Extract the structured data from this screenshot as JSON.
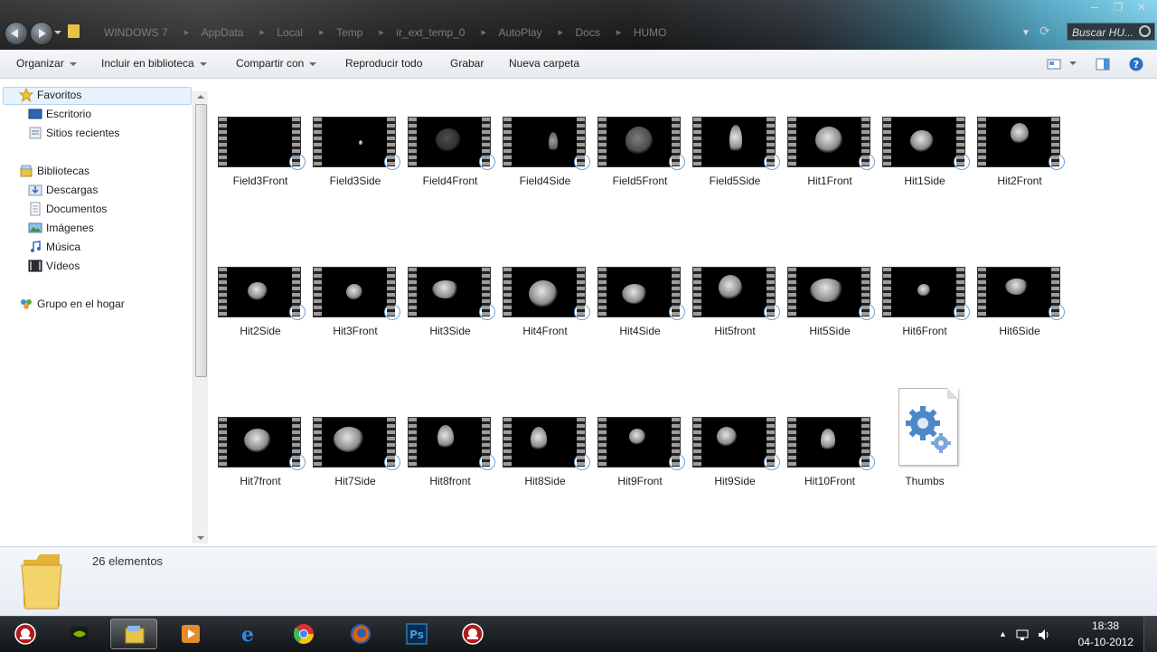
{
  "address": {
    "crumbs": [
      "WINDOWS 7",
      "AppData",
      "Local",
      "Temp",
      "ir_ext_temp_0",
      "AutoPlay",
      "Docs",
      "HUMO"
    ],
    "search_placeholder": "Buscar HU..."
  },
  "toolbar": {
    "organize": "Organizar",
    "include": "Incluir en biblioteca",
    "share": "Compartir con",
    "play_all": "Reproducir todo",
    "burn": "Grabar",
    "new_folder": "Nueva carpeta"
  },
  "sidebar": {
    "favorites": "Favoritos",
    "favorites_items": [
      "Escritorio",
      "Sitios recientes"
    ],
    "libraries": "Bibliotecas",
    "libraries_items": [
      "Descargas",
      "Documentos",
      "Imágenes",
      "Música",
      "Vídeos"
    ],
    "homegroup": "Grupo en el hogar"
  },
  "files": [
    {
      "name": "Field3Front",
      "type": "video"
    },
    {
      "name": "Field3Side",
      "type": "video"
    },
    {
      "name": "Field4Front",
      "type": "video"
    },
    {
      "name": "Field4Side",
      "type": "video"
    },
    {
      "name": "Field5Front",
      "type": "video"
    },
    {
      "name": "Field5Side",
      "type": "video"
    },
    {
      "name": "Hit1Front",
      "type": "video"
    },
    {
      "name": "Hit1Side",
      "type": "video"
    },
    {
      "name": "Hit2Front",
      "type": "video"
    },
    {
      "name": "Hit2Side",
      "type": "video"
    },
    {
      "name": "Hit3Front",
      "type": "video"
    },
    {
      "name": "Hit3Side",
      "type": "video"
    },
    {
      "name": "Hit4Front",
      "type": "video"
    },
    {
      "name": "Hit4Side",
      "type": "video"
    },
    {
      "name": "Hit5front",
      "type": "video"
    },
    {
      "name": "Hit5Side",
      "type": "video"
    },
    {
      "name": "Hit6Front",
      "type": "video"
    },
    {
      "name": "Hit6Side",
      "type": "video"
    },
    {
      "name": "Hit7front",
      "type": "video"
    },
    {
      "name": "Hit7Side",
      "type": "video"
    },
    {
      "name": "Hit8front",
      "type": "video"
    },
    {
      "name": "Hit8Side",
      "type": "video"
    },
    {
      "name": "Hit9Front",
      "type": "video"
    },
    {
      "name": "Hit9Side",
      "type": "video"
    },
    {
      "name": "Hit10Front",
      "type": "video"
    },
    {
      "name": "Thumbs",
      "type": "system-file"
    }
  ],
  "details": {
    "count": "26 elementos"
  },
  "taskbar": {
    "apps": [
      "app-icon",
      "nvidia-icon",
      "explorer-icon",
      "media-player-icon",
      "ie-icon",
      "chrome-icon",
      "firefox-icon",
      "photoshop-icon",
      "app-icon"
    ],
    "time": "18:38",
    "date": "04-10-2012"
  }
}
